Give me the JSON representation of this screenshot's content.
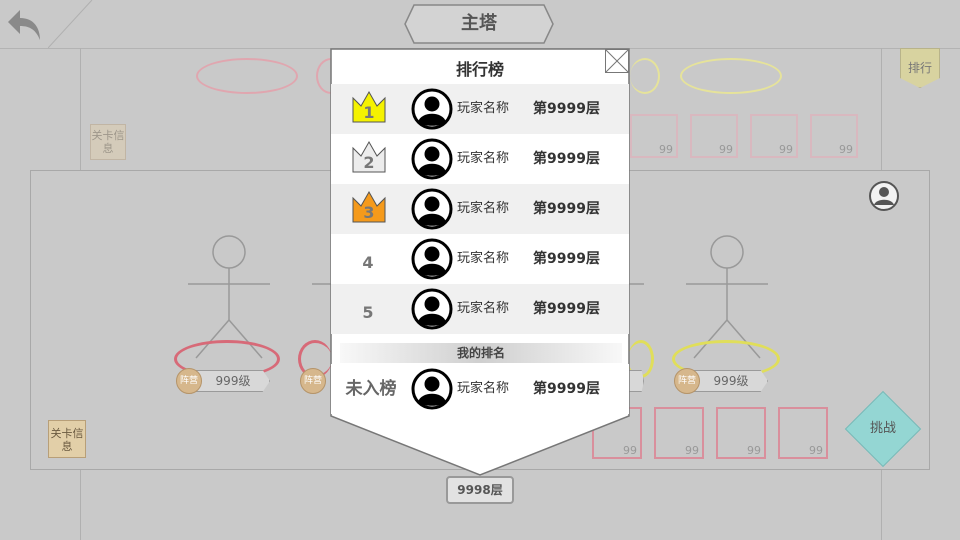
{
  "header": {
    "title": "主塔",
    "back_icon": "back-arrow-icon"
  },
  "side": {
    "rank_tab": "排行",
    "stage_info": "关卡信息"
  },
  "scene": {
    "characters": [
      {
        "level": "999级",
        "faction": "阵营",
        "ring": "#d76a78"
      },
      {
        "level": "",
        "faction": "阵营",
        "ring": "#d76a78"
      },
      {
        "level": "",
        "faction": "",
        "ring": "#e0de5a"
      },
      {
        "level": "999级",
        "faction": "阵营",
        "ring": "#e0de5a"
      }
    ],
    "slot_count": "99",
    "challenge_button": "挑战",
    "current_floor": "9998层"
  },
  "leaderboard": {
    "title": "排行榜",
    "rows": [
      {
        "rank": "1",
        "crown_color": "#f5f200",
        "name": "玩家名称",
        "floor": "第9999层"
      },
      {
        "rank": "2",
        "crown_color": "#ececec",
        "name": "玩家名称",
        "floor": "第9999层"
      },
      {
        "rank": "3",
        "crown_color": "#f59a1b",
        "name": "玩家名称",
        "floor": "第9999层"
      },
      {
        "rank": "4",
        "name": "玩家名称",
        "floor": "第9999层"
      },
      {
        "rank": "5",
        "name": "玩家名称",
        "floor": "第9999层"
      }
    ],
    "my_rank_label": "我的排名",
    "my_rank": {
      "status": "未入榜",
      "name": "玩家名称",
      "floor": "第9999层"
    }
  }
}
